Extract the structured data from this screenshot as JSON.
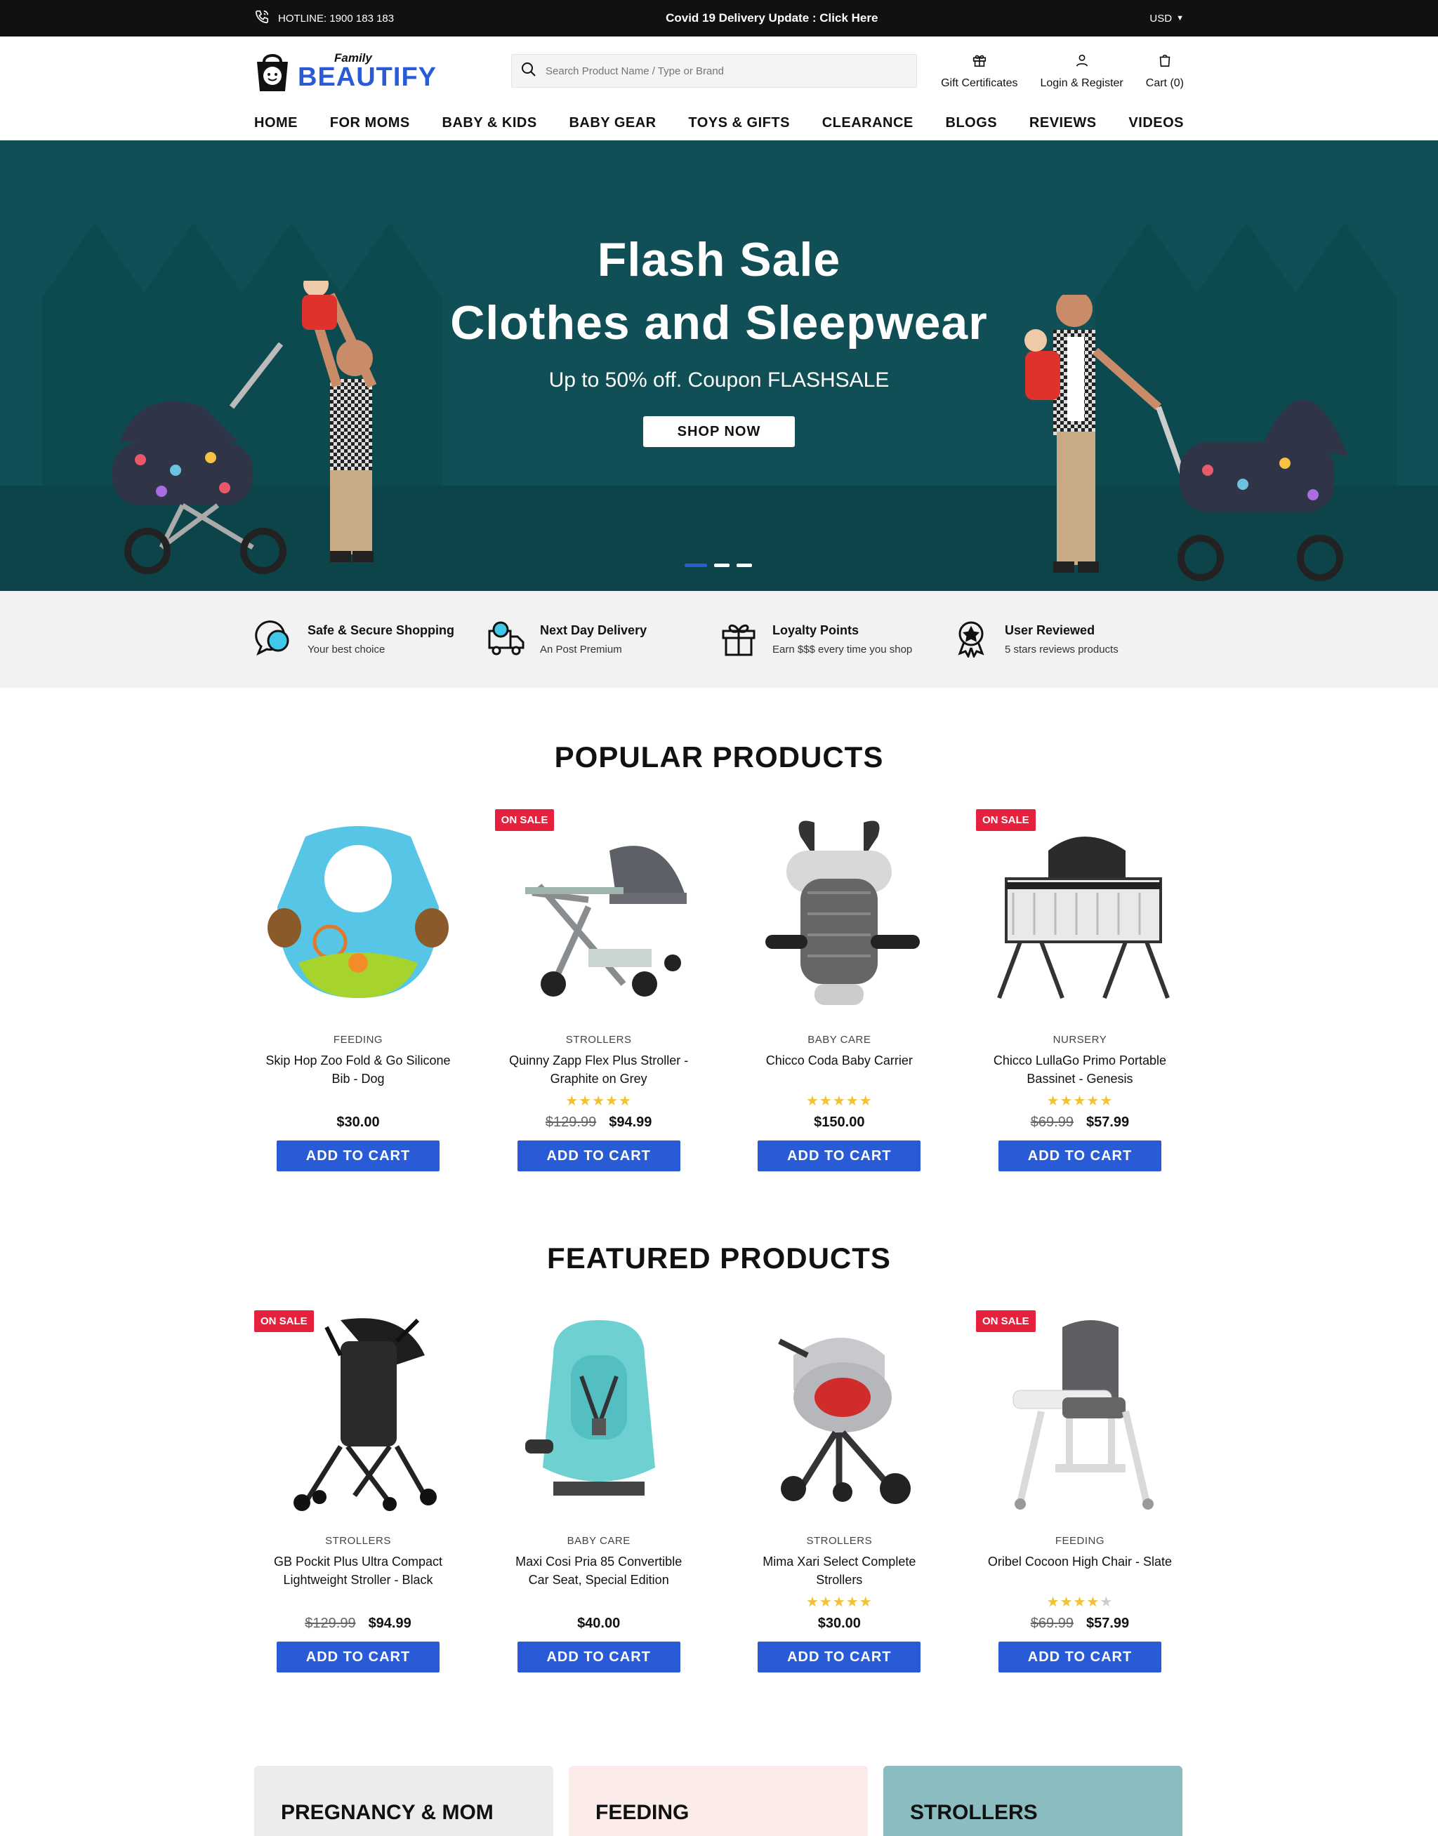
{
  "topbar": {
    "hotline": "HOTLINE: 1900 183 183",
    "notice": "Covid 19 Delivery Update : Click Here",
    "currency": "USD"
  },
  "header": {
    "logo_small": "Family",
    "logo_brand": "BEAUTIFY",
    "search_placeholder": "Search Product Name / Type or Brand",
    "gift": "Gift Certificates",
    "login": "Login & Register",
    "cart": "Cart (0)"
  },
  "nav": [
    "HOME",
    "FOR MOMS",
    "BABY & KIDS",
    "BABY GEAR",
    "TOYS & GIFTS",
    "CLEARANCE",
    "BLOGS",
    "REVIEWS",
    "VIDEOS"
  ],
  "hero": {
    "line1": "Flash Sale",
    "line2": "Clothes and Sleepwear",
    "sub": "Up to 50% off. Coupon FLASHSALE",
    "cta": "SHOP NOW",
    "slides": 3,
    "active_slide": 1
  },
  "features": [
    {
      "title": "Safe & Secure Shopping",
      "sub": "Your best choice",
      "icon": "chat-bubbles-icon"
    },
    {
      "title": "Next Day Delivery",
      "sub": "An Post Premium",
      "icon": "delivery-truck-icon"
    },
    {
      "title": "Loyalty Points",
      "sub": "Earn $$$ every time you shop",
      "icon": "gift-box-icon"
    },
    {
      "title": "User Reviewed",
      "sub": "5 stars reviews products",
      "icon": "award-ribbon-icon"
    }
  ],
  "popular": {
    "title": "POPULAR PRODUCTS",
    "items": [
      {
        "cat": "FEEDING",
        "name": "Skip Hop Zoo Fold & Go Silicone Bib - Dog",
        "old": "",
        "price": "$30.00",
        "stars": 0,
        "sale": false
      },
      {
        "cat": "STROLLERS",
        "name": "Quinny Zapp Flex Plus Stroller - Graphite on Grey",
        "old": "$129.99",
        "price": "$94.99",
        "stars": 5,
        "sale": true
      },
      {
        "cat": "BABY CARE",
        "name": "Chicco Coda Baby Carrier",
        "old": "",
        "price": "$150.00",
        "stars": 5,
        "sale": false
      },
      {
        "cat": "NURSERY",
        "name": "Chicco LullaGo Primo Portable Bassinet - Genesis",
        "old": "$69.99",
        "price": "$57.99",
        "stars": 5,
        "sale": true
      }
    ]
  },
  "featured": {
    "title": "FEATURED PRODUCTS",
    "items": [
      {
        "cat": "STROLLERS",
        "name": "GB Pockit Plus Ultra Compact Lightweight Stroller - Black",
        "old": "$129.99",
        "price": "$94.99",
        "stars": 0,
        "sale": true
      },
      {
        "cat": "BABY CARE",
        "name": "Maxi Cosi Pria 85 Convertible Car Seat, Special Edition",
        "old": "",
        "price": "$40.00",
        "stars": 0,
        "sale": false
      },
      {
        "cat": "STROLLERS",
        "name": "Mima Xari Select Complete Strollers",
        "old": "",
        "price": "$30.00",
        "stars": 5,
        "sale": false
      },
      {
        "cat": "FEEDING",
        "name": "Oribel Cocoon High Chair - Slate",
        "old": "$69.99",
        "price": "$57.99",
        "stars": 4,
        "sale": true
      }
    ]
  },
  "labels": {
    "sale": "ON SALE",
    "add": "ADD TO CART"
  },
  "categories": [
    {
      "label": "PREGNANCY & MOM",
      "color": "#ececec"
    },
    {
      "label": "FEEDING",
      "color": "#fbecea"
    },
    {
      "label": "STROLLERS",
      "color": "#8bbcbf"
    }
  ],
  "colors": {
    "accent": "#2a5bd7",
    "sale": "#e5213e",
    "hero_bg": "#0f4f55",
    "star": "#f1c232"
  }
}
